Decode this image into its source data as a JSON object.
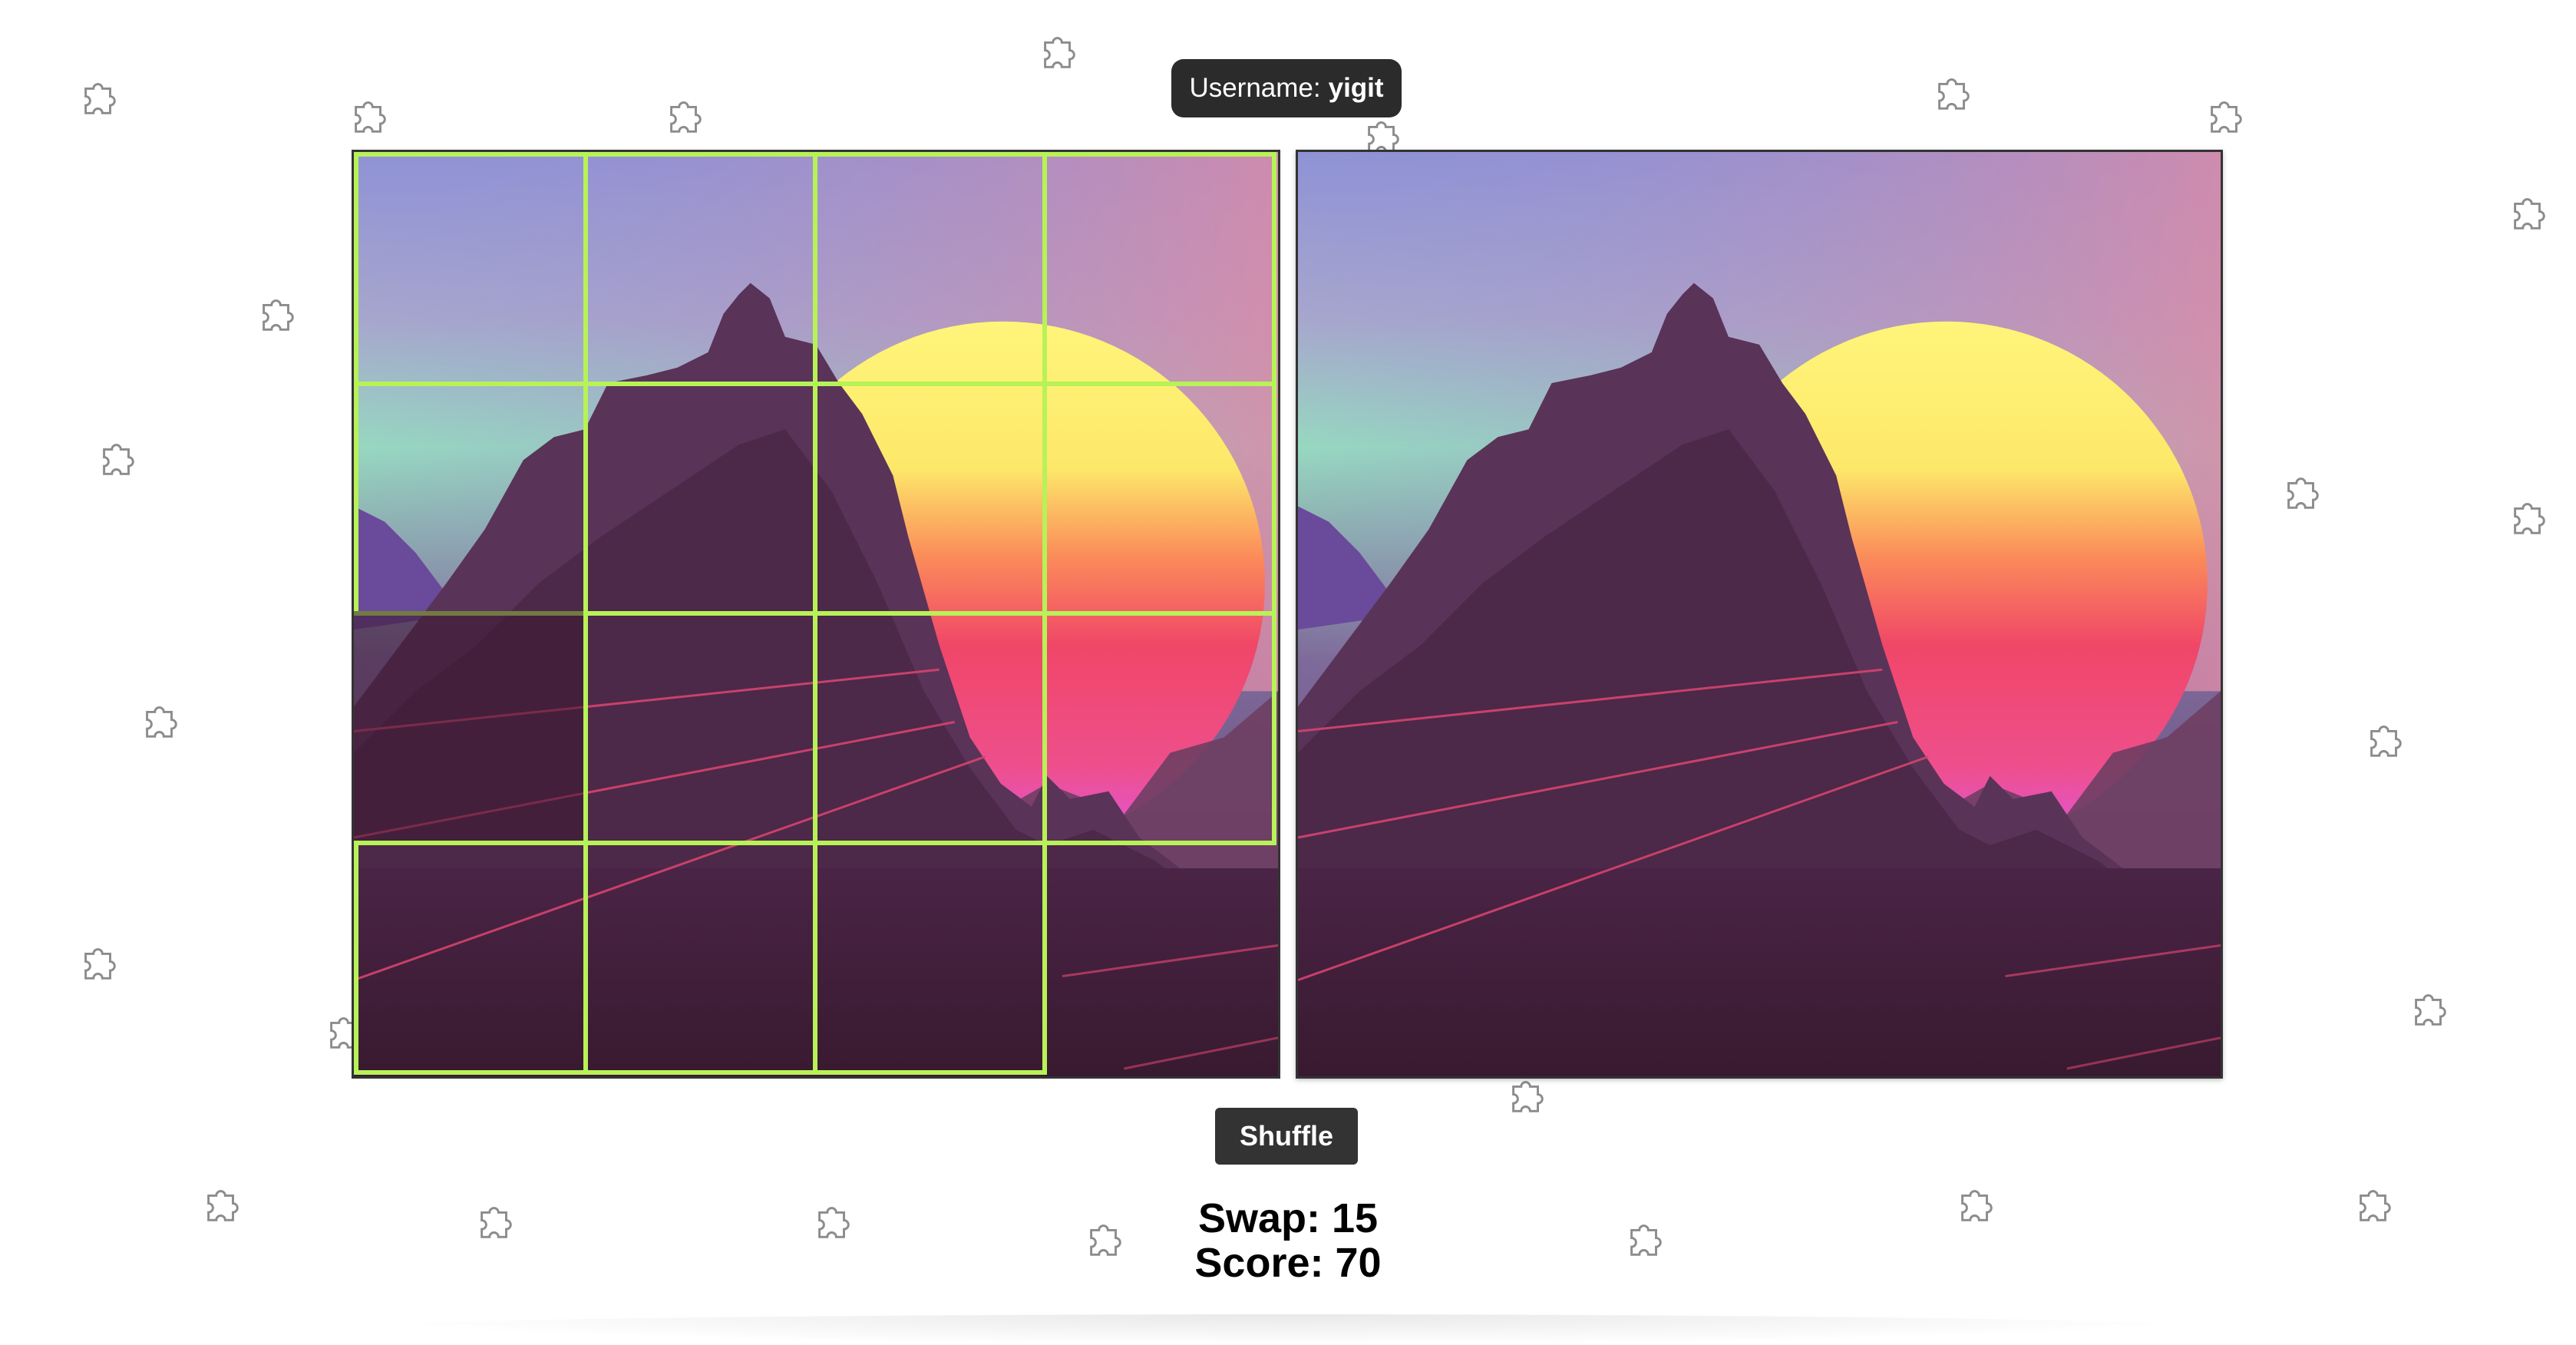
{
  "header": {
    "username_label": "Username:",
    "username_value": "yigit"
  },
  "puzzle": {
    "grid_rows": 4,
    "grid_cols": 4,
    "highlight_color": "#b7f257",
    "image_theme": "synthwave sunset over mountains"
  },
  "controls": {
    "shuffle_label": "Shuffle"
  },
  "stats": {
    "swap_label": "Swap:",
    "swap_value": "15",
    "score_label": "Score:",
    "score_value": "70"
  },
  "icons": {
    "background": "puzzle-piece-icon"
  }
}
